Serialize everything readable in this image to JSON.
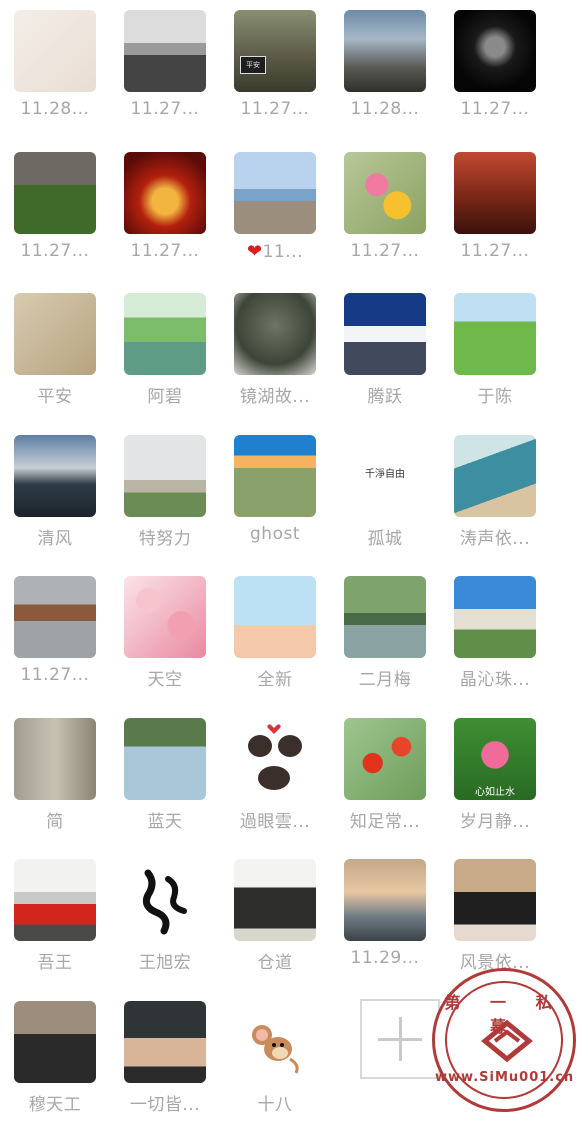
{
  "contacts": [
    {
      "name": "11.28...",
      "art": "sketch"
    },
    {
      "name": "11.27...",
      "art": "interior"
    },
    {
      "name": "11.27...",
      "art": "person-sign"
    },
    {
      "name": "11.28...",
      "art": "mountains-mist"
    },
    {
      "name": "11.27...",
      "art": "dark-portrait"
    },
    {
      "name": "11.27...",
      "art": "tea-field"
    },
    {
      "name": "11.27...",
      "art": "red-lantern"
    },
    {
      "name": "11...",
      "art": "couple-rocks",
      "heart": true
    },
    {
      "name": "11.27...",
      "art": "flowers"
    },
    {
      "name": "11.27...",
      "art": "red-chair"
    },
    {
      "name": "平安",
      "art": "beige-figure"
    },
    {
      "name": "阿碧",
      "art": "willow-lake"
    },
    {
      "name": "镜湖故...",
      "art": "foggy-tree"
    },
    {
      "name": "腾跃",
      "art": "snow-peaks"
    },
    {
      "name": "于陈",
      "art": "green-meadow"
    },
    {
      "name": "清风",
      "art": "sunset-sea"
    },
    {
      "name": "特努力",
      "art": "statue"
    },
    {
      "name": "ghost",
      "art": "town-view"
    },
    {
      "name": "孤城",
      "art": "text-white"
    },
    {
      "name": "涛声依...",
      "art": "sea-arch"
    },
    {
      "name": "11.27...",
      "art": "prayer-beads"
    },
    {
      "name": "天空",
      "art": "pink-blossom"
    },
    {
      "name": "全新",
      "art": "lighthouse"
    },
    {
      "name": "二月梅",
      "art": "canal"
    },
    {
      "name": "晶沁珠...",
      "art": "campus"
    },
    {
      "name": "简",
      "art": "man-wall"
    },
    {
      "name": "蓝天",
      "art": "man-glasses"
    },
    {
      "name": "過眼雲...",
      "art": "hedgehogs"
    },
    {
      "name": "知足常...",
      "art": "red-poppies"
    },
    {
      "name": "岁月静...",
      "art": "lotus"
    },
    {
      "name": "吾王",
      "art": "red-car"
    },
    {
      "name": "王旭宏",
      "art": "calligraphy"
    },
    {
      "name": "仓道",
      "art": "atv"
    },
    {
      "name": "11.29...",
      "art": "railway"
    },
    {
      "name": "风景依...",
      "art": "man-suit"
    },
    {
      "name": "穆天工",
      "art": "young-man"
    },
    {
      "name": "一切皆...",
      "art": "girl-dark"
    },
    {
      "name": "十八",
      "art": "mouse-cartoon"
    }
  ],
  "text_in_pictures": {
    "sign": "平安",
    "white_avatar": "千淨自由",
    "lotus_caption": "心如止水"
  },
  "add_button": {
    "label": "add-member"
  },
  "watermark": {
    "top_text": "第 一 私 募",
    "url": "www.SiMu001.cn",
    "color": "#b03a3a"
  }
}
